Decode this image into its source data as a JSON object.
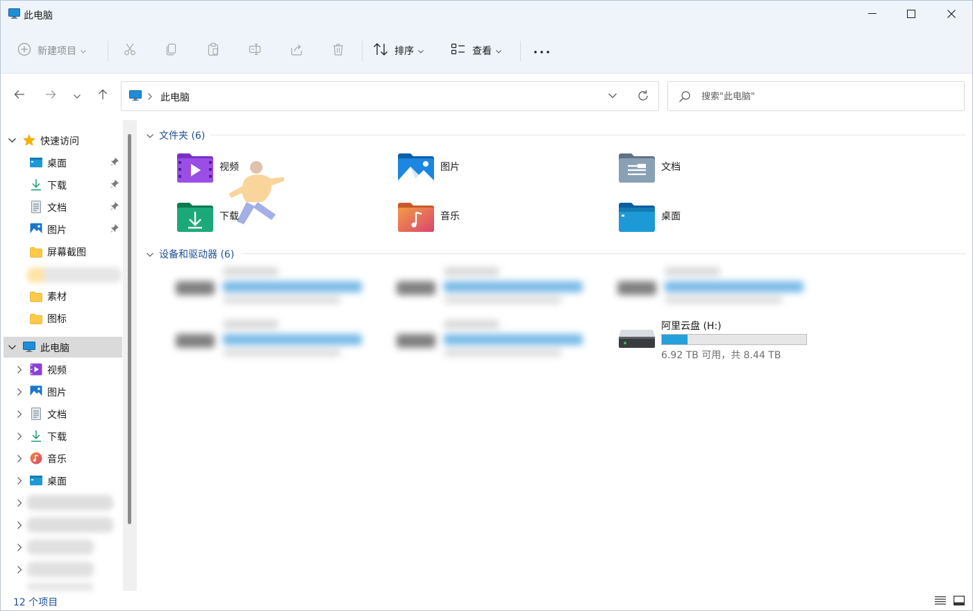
{
  "window": {
    "title": "此电脑"
  },
  "toolbar": {
    "new_label": "新建项目",
    "sort_label": "排序",
    "view_label": "查看",
    "more": "•••"
  },
  "address": {
    "breadcrumb": "此电脑",
    "search_placeholder": "搜索\"此电脑\""
  },
  "sidebar": {
    "quick_access": "快速访问",
    "quick_items": [
      {
        "label": "桌面",
        "icon": "desktop-icon"
      },
      {
        "label": "下载",
        "icon": "download-icon"
      },
      {
        "label": "文档",
        "icon": "document-icon"
      },
      {
        "label": "图片",
        "icon": "picture-icon"
      },
      {
        "label": "屏幕截图",
        "icon": "folder-icon"
      },
      {
        "label": "素材",
        "icon": "folder-icon"
      },
      {
        "label": "图标",
        "icon": "folder-icon"
      }
    ],
    "this_pc": "此电脑",
    "pc_items": [
      {
        "label": "视频",
        "icon": "video-icon"
      },
      {
        "label": "图片",
        "icon": "picture-icon"
      },
      {
        "label": "文档",
        "icon": "document-icon"
      },
      {
        "label": "下载",
        "icon": "download-icon"
      },
      {
        "label": "音乐",
        "icon": "music-icon"
      },
      {
        "label": "桌面",
        "icon": "desktop-icon"
      }
    ]
  },
  "main": {
    "folders_header": "文件夹 (6)",
    "folders": [
      {
        "label": "视频",
        "icon": "video-folder-icon"
      },
      {
        "label": "图片",
        "icon": "pictures-folder-icon"
      },
      {
        "label": "文档",
        "icon": "documents-folder-icon"
      },
      {
        "label": "下载",
        "icon": "downloads-folder-icon"
      },
      {
        "label": "音乐",
        "icon": "music-folder-icon"
      },
      {
        "label": "桌面",
        "icon": "desktop-folder-icon"
      }
    ],
    "drives_header": "设备和驱动器 (6)",
    "drive": {
      "name": "阿里云盘 (H:)",
      "stats": "6.92 TB 可用，共 8.44 TB",
      "used_fraction": 0.18
    }
  },
  "status": {
    "count": "12 个项目"
  },
  "colors": {
    "accent": "#1f4e99",
    "bar_fill": "#26a0da",
    "titlebar_bg": "#eef4f9"
  }
}
